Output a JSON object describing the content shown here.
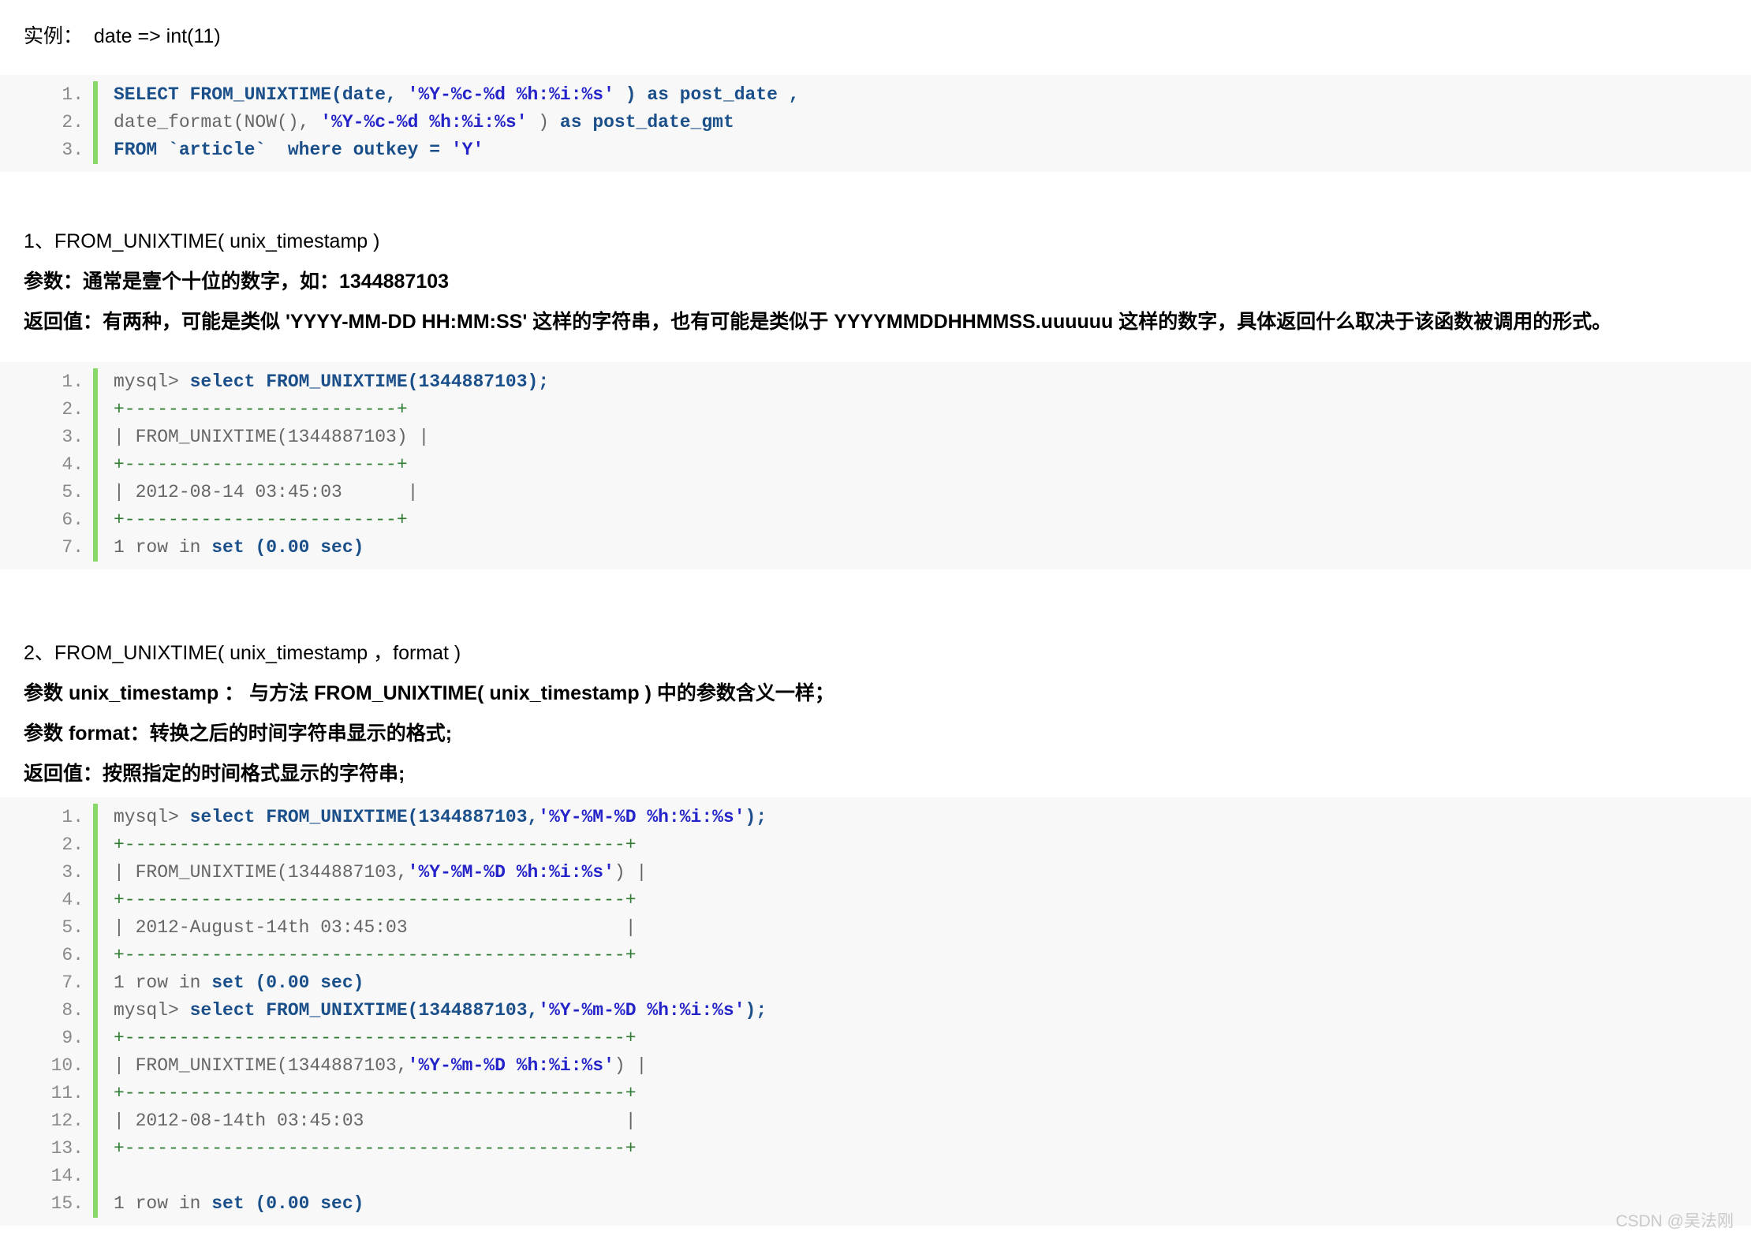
{
  "intro": {
    "label": "实例：  date => int(11)"
  },
  "code_block_1": {
    "lines": [
      {
        "no": "1.",
        "segments": [
          {
            "t": "SELECT FROM_UNIXTIME(date, ",
            "c": "kw"
          },
          {
            "t": "'%Y-%c-%d %h:%i:%s'",
            "c": "str"
          },
          {
            "t": " ) as post_date ,",
            "c": "kw"
          }
        ]
      },
      {
        "no": "2.",
        "segments": [
          {
            "t": "date_format(NOW(), ",
            "c": "plain"
          },
          {
            "t": "'%Y-%c-%d %h:%i:%s'",
            "c": "str"
          },
          {
            "t": " ) ",
            "c": "plain"
          },
          {
            "t": "as post_date_gmt",
            "c": "kw"
          }
        ]
      },
      {
        "no": "3.",
        "segments": [
          {
            "t": "FROM `article`  where outkey = ",
            "c": "kw"
          },
          {
            "t": "'Y'",
            "c": "str"
          }
        ]
      }
    ]
  },
  "section_1": {
    "heading": "1、FROM_UNIXTIME( unix_timestamp )",
    "param": "参数：通常是壹个十位的数字，如：1344887103",
    "returns": "返回值：有两种，可能是类似 'YYYY-MM-DD HH:MM:SS' 这样的字符串，也有可能是类似于 YYYYMMDDHHMMSS.uuuuuu 这样的数字，具体返回什么取决于该函数被调用的形式。"
  },
  "code_block_2": {
    "lines": [
      {
        "no": "1.",
        "segments": [
          {
            "t": "mysql> ",
            "c": "plain"
          },
          {
            "t": "select FROM_UNIXTIME(1344887103);",
            "c": "kw"
          }
        ]
      },
      {
        "no": "2.",
        "segments": [
          {
            "t": "+-------------------------+",
            "c": "sep"
          }
        ]
      },
      {
        "no": "3.",
        "segments": [
          {
            "t": "| FROM_UNIXTIME(1344887103) |",
            "c": "plain"
          }
        ]
      },
      {
        "no": "4.",
        "segments": [
          {
            "t": "+-------------------------+",
            "c": "sep"
          }
        ]
      },
      {
        "no": "5.",
        "segments": [
          {
            "t": "| 2012-08-14 03:45:03      |",
            "c": "plain"
          }
        ]
      },
      {
        "no": "6.",
        "segments": [
          {
            "t": "+-------------------------+",
            "c": "sep"
          }
        ]
      },
      {
        "no": "7.",
        "segments": [
          {
            "t": "1 row in ",
            "c": "plain"
          },
          {
            "t": "set (0.00 sec)",
            "c": "kw"
          }
        ]
      }
    ]
  },
  "section_2": {
    "heading": "2、FROM_UNIXTIME( unix_timestamp ，format )",
    "param_timestamp": "参数 unix_timestamp ： 与方法 FROM_UNIXTIME( unix_timestamp ) 中的参数含义一样；",
    "param_format": "参数 format：转换之后的时间字符串显示的格式;",
    "returns": "返回值：按照指定的时间格式显示的字符串;"
  },
  "code_block_3": {
    "lines": [
      {
        "no": "1.",
        "segments": [
          {
            "t": "mysql> ",
            "c": "plain"
          },
          {
            "t": "select FROM_UNIXTIME(1344887103,",
            "c": "kw"
          },
          {
            "t": "'%Y-%M-%D %h:%i:%s'",
            "c": "str"
          },
          {
            "t": ");",
            "c": "kw"
          }
        ]
      },
      {
        "no": "2.",
        "segments": [
          {
            "t": "+----------------------------------------------+",
            "c": "sep"
          }
        ]
      },
      {
        "no": "3.",
        "segments": [
          {
            "t": "| FROM_UNIXTIME(1344887103,",
            "c": "plain"
          },
          {
            "t": "'%Y-%M-%D %h:%i:%s'",
            "c": "str"
          },
          {
            "t": ") |",
            "c": "plain"
          }
        ]
      },
      {
        "no": "4.",
        "segments": [
          {
            "t": "+----------------------------------------------+",
            "c": "sep"
          }
        ]
      },
      {
        "no": "5.",
        "segments": [
          {
            "t": "| 2012-August-14th 03:45:03                    |",
            "c": "plain"
          }
        ]
      },
      {
        "no": "6.",
        "segments": [
          {
            "t": "+----------------------------------------------+",
            "c": "sep"
          }
        ]
      },
      {
        "no": "7.",
        "segments": [
          {
            "t": "1 row in ",
            "c": "plain"
          },
          {
            "t": "set (0.00 sec)",
            "c": "kw"
          }
        ]
      },
      {
        "no": "8.",
        "segments": [
          {
            "t": "mysql> ",
            "c": "plain"
          },
          {
            "t": "select FROM_UNIXTIME(1344887103,",
            "c": "kw"
          },
          {
            "t": "'%Y-%m-%D %h:%i:%s'",
            "c": "str"
          },
          {
            "t": ");",
            "c": "kw"
          }
        ]
      },
      {
        "no": "9.",
        "segments": [
          {
            "t": "+----------------------------------------------+",
            "c": "sep"
          }
        ]
      },
      {
        "no": "10.",
        "segments": [
          {
            "t": "| FROM_UNIXTIME(1344887103,",
            "c": "plain"
          },
          {
            "t": "'%Y-%m-%D %h:%i:%s'",
            "c": "str"
          },
          {
            "t": ") |",
            "c": "plain"
          }
        ]
      },
      {
        "no": "11.",
        "segments": [
          {
            "t": "+----------------------------------------------+",
            "c": "sep"
          }
        ]
      },
      {
        "no": "12.",
        "segments": [
          {
            "t": "| 2012-08-14th 03:45:03                        |",
            "c": "plain"
          }
        ]
      },
      {
        "no": "13.",
        "segments": [
          {
            "t": "+----------------------------------------------+",
            "c": "sep"
          }
        ]
      },
      {
        "no": "14.",
        "segments": [
          {
            "t": "",
            "c": "plain"
          }
        ]
      },
      {
        "no": "15.",
        "segments": [
          {
            "t": "1 row in ",
            "c": "plain"
          },
          {
            "t": "set (0.00 sec)",
            "c": "kw"
          }
        ]
      }
    ]
  },
  "watermark": {
    "text": "CSDN @吴法刚"
  },
  "colors": {
    "code_bg": "#f8f8f8",
    "gutter_green": "#88d96a",
    "keyword_blue": "#1a4f8a",
    "string_blue": "#2323c9",
    "separator_green": "#2f7d32",
    "lineno_gray": "#8a8a8a",
    "watermark_gray": "#c9c9c9"
  }
}
